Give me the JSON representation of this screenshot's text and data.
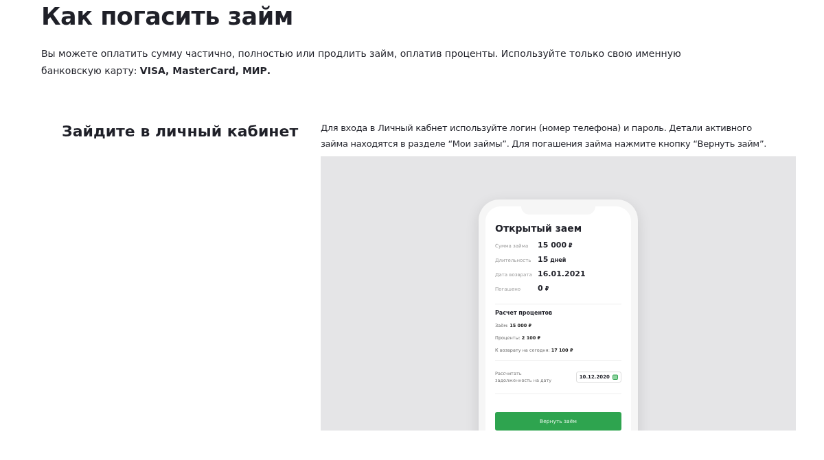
{
  "title": "Как погасить займ",
  "intro": "Вы можете оплатить сумму частично, полностью или продлить займ, оплатив проценты. Используйте только свою именную банковскую карту: **VISA, MasterCard, МИР.**",
  "step": {
    "heading": "Зайдите в личный кабинет",
    "text": "Для входа в Личный кабнет используйте логин (номер телефона) и пароль. Детали активного займа находятся в разделе “Мои займы”. Для погашения займа нажмите кнопку “Вернуть займ”."
  },
  "phone": {
    "title": "Открытый заем",
    "details": [
      {
        "label": "Сумма займа",
        "value": "15 000",
        "unit": "₽"
      },
      {
        "label": "Длительность",
        "value": "15",
        "unit": "дней"
      },
      {
        "label": "Дата возврата",
        "value": "16.01.2021"
      },
      {
        "label": "Погашено",
        "value": "0",
        "unit": "₽"
      }
    ],
    "calc_title": "Расчет процентов",
    "calc_lines": [
      "Заём: **15 000 ₽**",
      "Проценты: **2 100 ₽**",
      "К возврату на сегодня: **17 100 ₽**"
    ],
    "date_label": "Рассчитать задолженность на дату",
    "date_value": "10.12.2020",
    "button": "Вернуть заём"
  }
}
